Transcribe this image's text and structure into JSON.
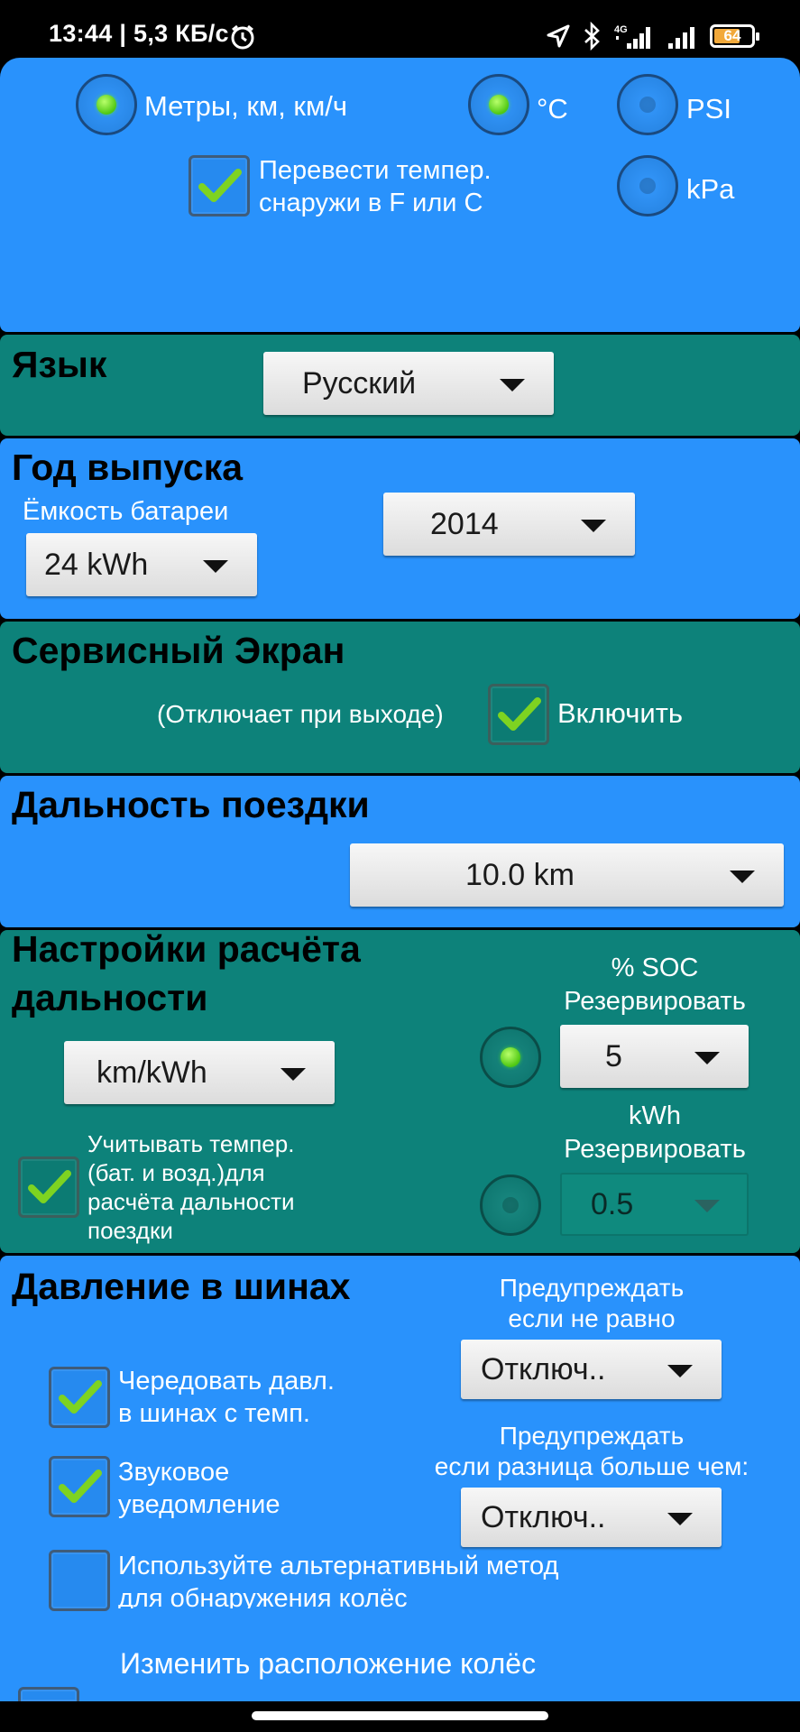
{
  "status_bar": {
    "time_speed": "13:44 | 5,3 КБ/с",
    "battery": "64",
    "battery_level_percent": 64,
    "icons": [
      "alarm-icon",
      "location-icon",
      "bluetooth-icon",
      "signal-4g-icon",
      "signal-icon",
      "battery-icon"
    ]
  },
  "units": {
    "metric_label": "Метры, км, км/ч",
    "celsius_label": "°C",
    "psi_label": "PSI",
    "kpa_label": "kPa",
    "convert_temp_line1": "Перевести темпер.",
    "convert_temp_line2": "снаружи в F или С"
  },
  "language": {
    "title": "Язык",
    "selected": "Русский"
  },
  "model_year": {
    "title": "Год выпуска",
    "battery_label": "Ёмкость батареи",
    "battery_selected": "24 kWh",
    "year_selected": "2014"
  },
  "service_screen": {
    "title": "Сервисный Экран",
    "note": "(Отключает при выходе)",
    "enable_label": "Включить"
  },
  "trip_distance": {
    "title": "Дальность поездки",
    "selected": "10.0 km"
  },
  "range_calc": {
    "title_line1": "Настройки расчёта",
    "title_line2": "дальности",
    "unit_selected": "km/kWh",
    "soc_label_line1": "% SOC",
    "soc_label_line2": "Резервировать",
    "soc_selected": "5",
    "kwh_label_line1": "kWh",
    "kwh_label_line2": "Резервировать",
    "kwh_selected": "0.5",
    "temp_check_line1": "Учитывать темпер.",
    "temp_check_line2": "(бат. и возд.)для",
    "temp_check_line3": "расчёта дальности",
    "temp_check_line4": "поездки"
  },
  "tire_pressure": {
    "title": "Давление в шинах",
    "warn_unequal_line1": "Предупреждать",
    "warn_unequal_line2": "если не равно",
    "warn_unequal_selected": "Отключ..",
    "warn_diff_line1": "Предупреждать",
    "warn_diff_line2": "если разница больше чем:",
    "warn_diff_selected": "Отключ..",
    "alternate_line1": "Чередовать давл.",
    "alternate_line2": "в шинах с темп.",
    "sound_line1": "Звуковое",
    "sound_line2": "уведомление",
    "alt_method_line1": "Используйте альтернативный метод",
    "alt_method_line2": "для обнаружения колёс",
    "change_wheels": "Изменить расположение колёс"
  },
  "colors": {
    "blue_panel": "#2992fc",
    "teal_panel": "#0d827a",
    "check_green": "#7ed321"
  }
}
